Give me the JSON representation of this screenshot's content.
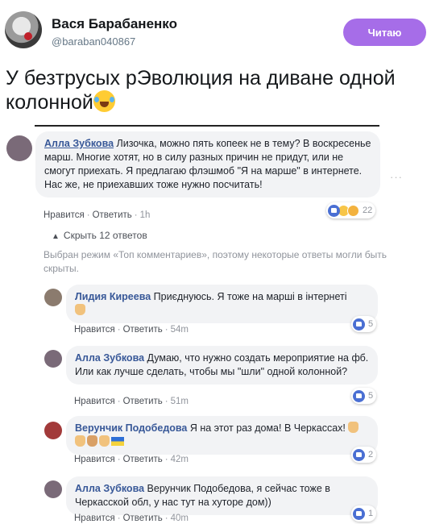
{
  "tweet": {
    "author_name": "Вася Барабаненко",
    "author_handle": "@baraban040867",
    "follow_label": "Читаю",
    "text": "У безтрусых рЭволюция на диване одной колонной",
    "emoji": "face-with-tears-of-joy"
  },
  "embed": {
    "main_comment": {
      "name": "Алла Зубкова",
      "text": "Лизочка, можно пять копеек не в тему? В воскресенье марш. Многие хотят, но в силу разных причин не придут, или не смогут приехать. Я предлагаю флэшмоб \"Я на марше\" в интернете. Нас же, не приехавших тоже нужно посчитать!",
      "like": "Нравится",
      "reply": "Ответить",
      "time": "1h",
      "reactions_count": "22"
    },
    "hide_replies": "Скрыть 12 ответов",
    "notice": "Выбран режим «Топ комментариев», поэтому некоторые ответы могли быть скрыты.",
    "replies": [
      {
        "name": "Лидия Киреева",
        "text": "Приєднуюсь. Я тоже на марші в інтернеті",
        "like": "Нравится",
        "reply": "Ответить",
        "time": "54m",
        "reactions_count": "5"
      },
      {
        "name": "Алла Зубкова",
        "text": "Думаю, что нужно создать мероприятие на фб. Или как лучше сделать, чтобы мы \"шли\" одной колонной?",
        "like": "Нравится",
        "reply": "Ответить",
        "time": "51m",
        "reactions_count": "5"
      },
      {
        "name": "Верунчик Подобедова",
        "text": "Я на этот раз дома! В Черкассах!",
        "like": "Нравится",
        "reply": "Ответить",
        "time": "42m",
        "reactions_count": "2"
      },
      {
        "name": "Алла Зубкова",
        "text": "Верунчик Подобедова, я сейчас тоже в Черкасской обл, у нас тут на хуторе дом))",
        "like": "Нравится",
        "reply": "Ответить",
        "time": "40m",
        "reactions_count": "1"
      }
    ]
  },
  "colors": {
    "follow_button": "#a66de8",
    "link_name": "#385898",
    "meta_gray": "#90949c",
    "bubble_bg": "#f2f3f5"
  }
}
